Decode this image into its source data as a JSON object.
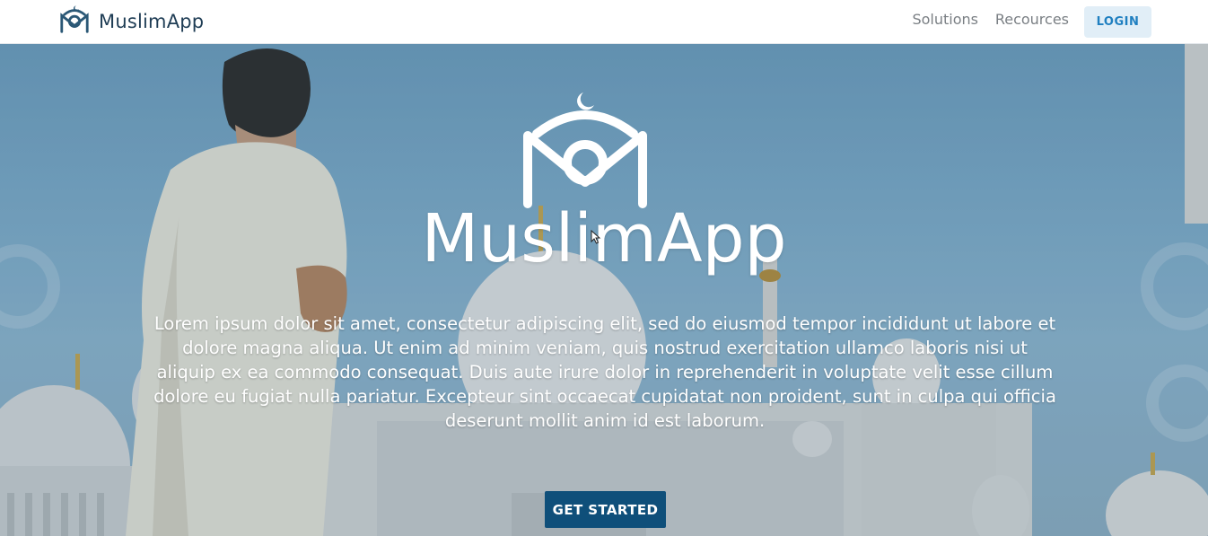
{
  "brand": {
    "name": "MuslimApp",
    "logo_icon": "muslimapp-logo-icon",
    "color": "#1f3d55"
  },
  "nav": {
    "links": [
      {
        "label": "Solutions"
      },
      {
        "label": "Recources"
      }
    ],
    "login_label": "LOGIN"
  },
  "hero": {
    "title": "MuslimApp",
    "logo_icon": "muslimapp-logo-icon",
    "description": "Lorem ipsum dolor sit amet, consectetur adipiscing elit, sed do eiusmod tempor incididunt ut labore et dolore magna aliqua. Ut enim ad minim veniam, quis nostrud exercitation ullamco laboris nisi ut aliquip ex ea commodo consequat. Duis aute irure dolor in reprehenderit in voluptate velit esse cillum dolore eu fugiat nulla pariatur. Excepteur sint occaecat cupidatat non proident, sunt in culpa qui officia deserunt mollit anim id est laborum.",
    "cta_label": "GET STARTED",
    "background": "mosque-photo-with-man-in-white-robe"
  },
  "colors": {
    "primary": "#0f4f7a",
    "login_text": "#1f7fc0",
    "login_bg": "#e1eef7",
    "nav_text": "#7a7f84"
  }
}
